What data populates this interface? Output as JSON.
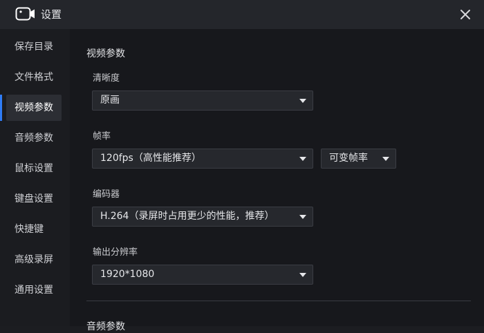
{
  "window": {
    "title": "设置",
    "icon": "camera-icon",
    "close_icon": "close-icon"
  },
  "sidebar": {
    "items": [
      {
        "label": "保存目录",
        "active": false
      },
      {
        "label": "文件格式",
        "active": false
      },
      {
        "label": "视频参数",
        "active": true
      },
      {
        "label": "音频参数",
        "active": false
      },
      {
        "label": "鼠标设置",
        "active": false
      },
      {
        "label": "键盘设置",
        "active": false
      },
      {
        "label": "快捷键",
        "active": false
      },
      {
        "label": "高级录屏",
        "active": false
      },
      {
        "label": "通用设置",
        "active": false
      }
    ]
  },
  "video": {
    "section_title": "视频参数",
    "quality": {
      "label": "清晰度",
      "value": "原画"
    },
    "framerate": {
      "label": "帧率",
      "value": "120fps（高性能推荐）",
      "mode_value": "可变帧率"
    },
    "encoder": {
      "label": "编码器",
      "value": "H.264（录屏时占用更少的性能，推荐）"
    },
    "resolution": {
      "label": "输出分辨率",
      "value": "1920*1080"
    }
  },
  "audio": {
    "section_title": "音频参数"
  },
  "colors": {
    "accent": "#2f7cf6",
    "background": "#17181c",
    "sidebar": "#1b1c20",
    "titlebar": "#24262b"
  }
}
